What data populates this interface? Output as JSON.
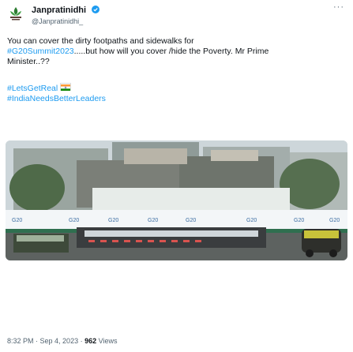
{
  "author": {
    "display_name": "Janpratinidhi",
    "handle": "@Janpratinidhi_",
    "verified_icon": "verified-badge-icon",
    "avatar_icon": "lotus-logo-icon"
  },
  "more_icon": "more-horizontal-icon",
  "tweet": {
    "line1": "You can cover the dirty footpaths  and sidewalks for",
    "line2_tag": "#G20Summit2023",
    "line2_rest": ".....but how will you cover /hide the Poverty. Mr Prime",
    "line3": "Minister..??",
    "hashtag1": "#LetsGetReal",
    "hashtag2": "#IndiaNeedsBetterLeaders"
  },
  "media": {
    "description_icon": "street-photo-image",
    "banner_text": "G20"
  },
  "meta": {
    "time": "8:32 PM",
    "separator": " · ",
    "date": "Sep 4, 2023",
    "views_count": "962",
    "views_label": " Views"
  },
  "colors": {
    "link": "#1d9bf0",
    "secondary": "#536471",
    "verified": "#1d9bf0"
  }
}
